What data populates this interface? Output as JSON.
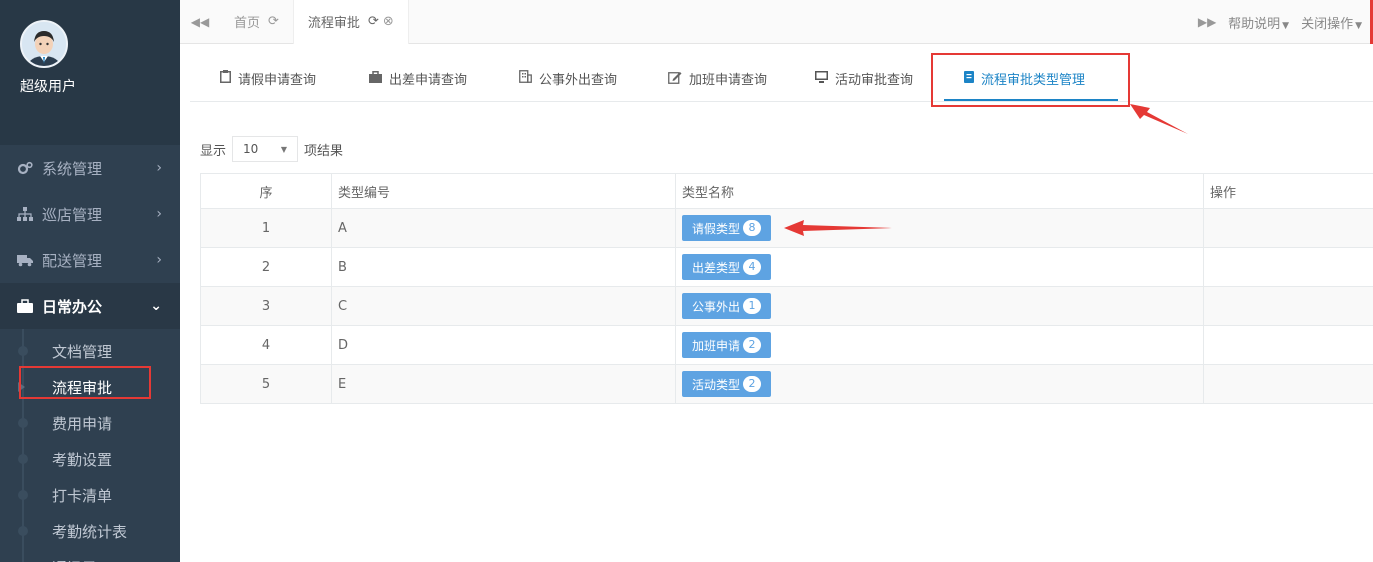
{
  "sidebar": {
    "username": "超级用户",
    "menu": [
      {
        "label": "系统管理",
        "icon": "gears-icon"
      },
      {
        "label": "巡店管理",
        "icon": "sitemap-icon"
      },
      {
        "label": "配送管理",
        "icon": "truck-icon"
      },
      {
        "label": "日常办公",
        "icon": "briefcase-icon"
      }
    ],
    "submenu": [
      "文档管理",
      "流程审批",
      "费用申请",
      "考勤设置",
      "打卡清单",
      "考勤统计表",
      "通讯录"
    ]
  },
  "topbar": {
    "tabs": [
      {
        "label": "首页"
      },
      {
        "label": "流程审批"
      }
    ],
    "help": "帮助说明",
    "close_ops": "关闭操作"
  },
  "subtabs": [
    {
      "label": "请假申请查询",
      "icon": "clipboard-icon"
    },
    {
      "label": "出差申请查询",
      "icon": "briefcase-icon"
    },
    {
      "label": "公事外出查询",
      "icon": "building-icon"
    },
    {
      "label": "加班申请查询",
      "icon": "edit-icon"
    },
    {
      "label": "活动审批查询",
      "icon": "monitor-icon"
    },
    {
      "label": "流程审批类型管理",
      "icon": "book-icon"
    }
  ],
  "length": {
    "prefix": "显示",
    "value": "10",
    "suffix": "项结果"
  },
  "table": {
    "headers": [
      "序",
      "类型编号",
      "类型名称",
      "操作"
    ],
    "rows": [
      {
        "index": "1",
        "code": "A",
        "name": "请假类型",
        "count": "8"
      },
      {
        "index": "2",
        "code": "B",
        "name": "出差类型",
        "count": "4"
      },
      {
        "index": "3",
        "code": "C",
        "name": "公事外出",
        "count": "1"
      },
      {
        "index": "4",
        "code": "D",
        "name": "加班申请",
        "count": "2"
      },
      {
        "index": "5",
        "code": "E",
        "name": "活动类型",
        "count": "2"
      }
    ]
  },
  "colors": {
    "sidebar_bg": "#2f4050",
    "accent": "#1c84c6",
    "button": "#5ea3e2",
    "highlight": "#e53935"
  }
}
